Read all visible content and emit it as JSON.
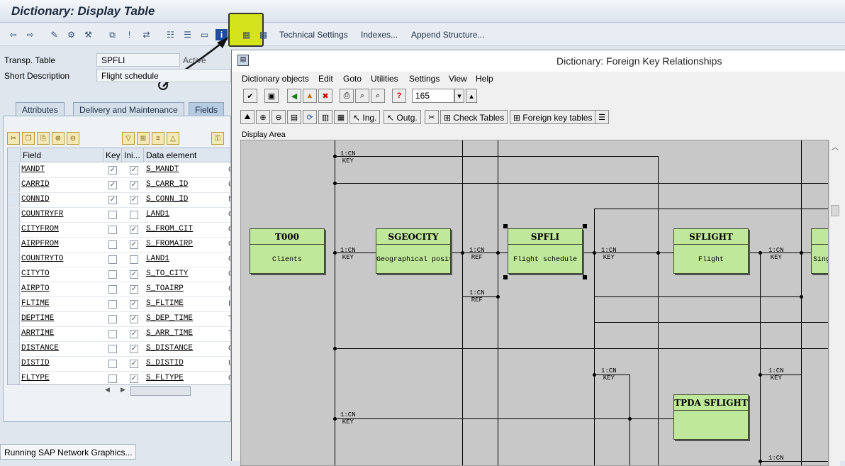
{
  "window": {
    "title": "Dictionary: Display Table"
  },
  "toolbar": {
    "technical_settings": "Technical Settings",
    "indexes": "Indexes...",
    "append_structure": "Append Structure..."
  },
  "header": {
    "table_label": "Transp. Table",
    "table_value": "SPFLI",
    "status": "Active",
    "short_desc_label": "Short Description",
    "short_desc_value": "Flight schedule"
  },
  "tabs": [
    "Attributes",
    "Delivery and Maintenance",
    "Fields"
  ],
  "grid": {
    "columns": [
      "Field",
      "Key",
      "Ini...",
      "Data element"
    ],
    "rows": [
      {
        "field": "MANDT",
        "key": true,
        "ini": true,
        "element": "S_MANDT",
        "extra": "C"
      },
      {
        "field": "CARRID",
        "key": true,
        "ini": true,
        "element": "S_CARR_ID",
        "extra": "C"
      },
      {
        "field": "CONNID",
        "key": true,
        "ini": true,
        "element": "S_CONN_ID",
        "extra": "N"
      },
      {
        "field": "COUNTRYFR",
        "key": false,
        "ini": false,
        "element": "LAND1",
        "extra": "C"
      },
      {
        "field": "CITYFROM",
        "key": false,
        "ini": true,
        "element": "S_FROM_CIT",
        "extra": "C"
      },
      {
        "field": "AIRPFROM",
        "key": false,
        "ini": true,
        "element": "S_FROMAIRP",
        "extra": "C"
      },
      {
        "field": "COUNTRYTO",
        "key": false,
        "ini": false,
        "element": "LAND1",
        "extra": "C"
      },
      {
        "field": "CITYTO",
        "key": false,
        "ini": true,
        "element": "S_TO_CITY",
        "extra": "C"
      },
      {
        "field": "AIRPTO",
        "key": false,
        "ini": true,
        "element": "S_TOAIRP",
        "extra": "C"
      },
      {
        "field": "FLTIME",
        "key": false,
        "ini": true,
        "element": "S_FLTIME",
        "extra": "I"
      },
      {
        "field": "DEPTIME",
        "key": false,
        "ini": true,
        "element": "S_DEP_TIME",
        "extra": "T"
      },
      {
        "field": "ARRTIME",
        "key": false,
        "ini": true,
        "element": "S_ARR_TIME",
        "extra": "T"
      },
      {
        "field": "DISTANCE",
        "key": false,
        "ini": true,
        "element": "S_DISTANCE",
        "extra": "Q"
      },
      {
        "field": "DISTID",
        "key": false,
        "ini": true,
        "element": "S_DISTID",
        "extra": "U"
      },
      {
        "field": "FLTYPE",
        "key": false,
        "ini": true,
        "element": "S_FLTYPE",
        "extra": "C"
      }
    ]
  },
  "statusbar": {
    "text": "Running SAP Network Graphics..."
  },
  "popup": {
    "title": "Dictionary: Foreign Key Relationships",
    "menu": [
      "Dictionary objects",
      "Edit",
      "Goto",
      "Utilities",
      "Settings",
      "View",
      "Help"
    ],
    "zoom_value": "165",
    "btn_ing": "Ing.",
    "btn_outg": "Outg.",
    "btn_check": "Check Tables",
    "btn_fk": "Foreign key tables",
    "display_label": "Display Area"
  },
  "graph": {
    "nodes": [
      {
        "name": "T000",
        "desc": "Clients"
      },
      {
        "name": "SGEOCITY",
        "desc": "Geographical positi"
      },
      {
        "name": "SPFLI",
        "desc": "Flight schedule"
      },
      {
        "name": "SFLIGHT",
        "desc": "Flight"
      },
      {
        "name": "",
        "desc": "Sing"
      },
      {
        "name": "TPDA SFLIGHT",
        "desc": ""
      }
    ],
    "relations": [
      {
        "card": "1:CN",
        "type": "KEY"
      },
      {
        "card": "1:CN",
        "type": "KEY"
      },
      {
        "card": "1:CN",
        "type": "REF"
      },
      {
        "card": "1:CN",
        "type": "KEY"
      },
      {
        "card": "1:CN",
        "type": "KEY"
      },
      {
        "card": "1:CN",
        "type": "REF"
      },
      {
        "card": "1:CN",
        "type": "KEY"
      },
      {
        "card": "1:CN",
        "type": "KEY"
      },
      {
        "card": "1:CN",
        "type": "KEY"
      },
      {
        "card": "1:CN",
        "type": ""
      }
    ]
  },
  "colors": {
    "highlight": "#d4e31a",
    "node_fill": "#bfe89a",
    "canvas": "#c8c8c8"
  }
}
